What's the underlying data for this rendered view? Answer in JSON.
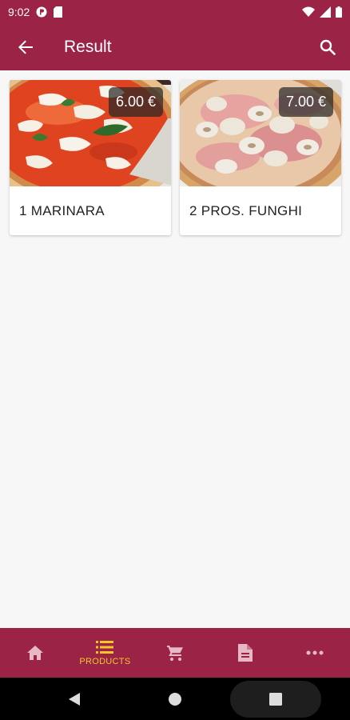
{
  "status_bar": {
    "time": "9:02"
  },
  "app_bar": {
    "title": "Result"
  },
  "products": [
    {
      "name": "1 MARINARA",
      "price": "6.00 €"
    },
    {
      "name": "2 PROS. FUNGHI",
      "price": "7.00 €"
    }
  ],
  "bottom_nav": {
    "active": "products",
    "items": [
      {
        "id": "home",
        "icon": "home-icon",
        "label": ""
      },
      {
        "id": "products",
        "icon": "list-icon",
        "label": "PRODUCTS"
      },
      {
        "id": "cart",
        "icon": "cart-icon",
        "label": ""
      },
      {
        "id": "orders",
        "icon": "document-icon",
        "label": ""
      },
      {
        "id": "more",
        "icon": "more-icon",
        "label": ""
      }
    ]
  },
  "colors": {
    "primary": "#9a2346",
    "active_nav": "#f5c52c",
    "inactive_nav": "#e7b8c6",
    "background": "#f7f7f7"
  }
}
